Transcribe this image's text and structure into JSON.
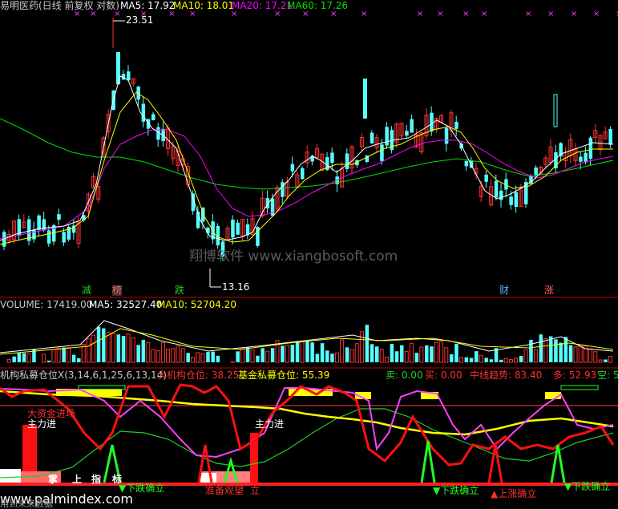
{
  "price_panel": {
    "title": "易明医药(日线 前复权 对数)",
    "ma5": "MA5: 17.92",
    "ma10": "MA10: 18.01",
    "ma20": "MA20: 17.21",
    "ma60": "MA60: 17.26",
    "high_label": "23.51",
    "low_label": "13.16",
    "watermark": "翔博软件 www.xiangbosoft.com",
    "badges": [
      "减",
      "榜",
      "跌",
      "财",
      "涨"
    ]
  },
  "volume_panel": {
    "volume": "VOLUME: 17419.00",
    "ma5": "MA5: 32527.40",
    "ma10": "MA10: 52704.20"
  },
  "indicator_panel": {
    "name": "机构私募仓位X(3,14,6,1,25,6,13,14)",
    "inst": "大机构仓位: 38.25",
    "fund": "基金私募仓位: 55.39",
    "sell": "卖: 0.00",
    "buy": "买: 0.00",
    "trend": "中线趋势: 83.40",
    "long": "多: 52.93",
    "short": "空: 5",
    "labels": {
      "main_in_1": "主力进",
      "main_in_2": "主力进",
      "fund_in": "大资金进场",
      "ready": "准备观望",
      "confirm": "立",
      "grip": "掌",
      "up": "上",
      "point": "指",
      "mark": "标",
      "down1": "▼下跌确立",
      "down2": "▼下跌确立",
      "down3": "▼下跌确立",
      "up1": "▲上涨确立",
      "lock_fall": "▼下跌确立"
    },
    "footer_site": "www.palmindex.com",
    "footer_note": "用到未来数据"
  },
  "colors": {
    "up": "#ff3232",
    "down": "#54ffff",
    "ma5": "#ffffff",
    "ma10": "#ffff00",
    "ma20": "#ff00ff",
    "ma60": "#00e000"
  }
}
